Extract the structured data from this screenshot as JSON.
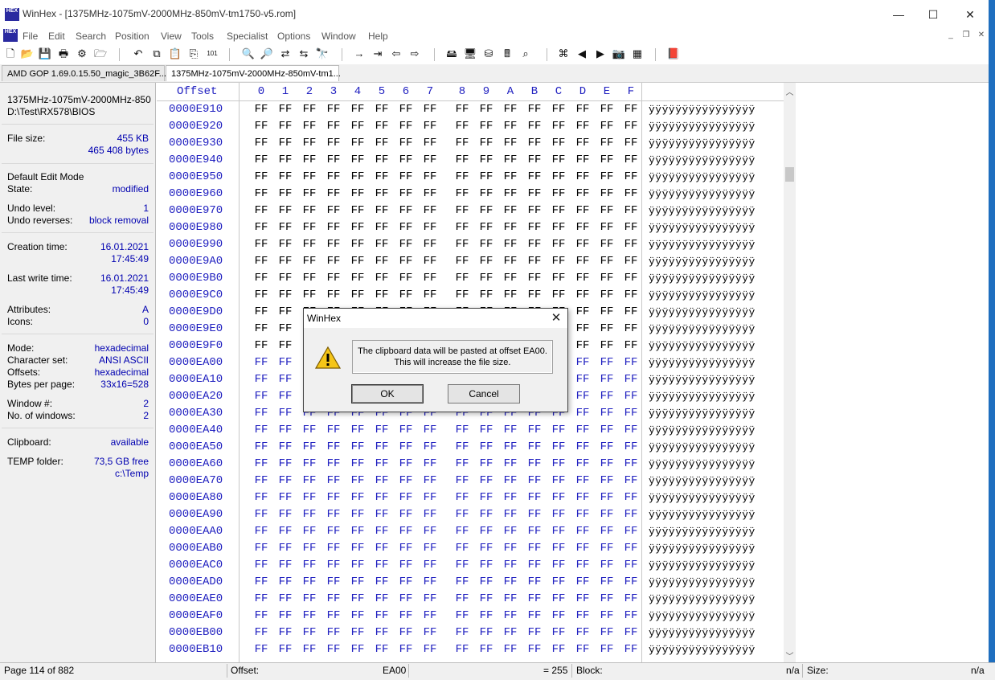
{
  "window": {
    "title": "WinHex - [1375MHz-1075mV-2000MHz-850mV-tm1750-v5.rom]",
    "app_icon_text": "HEX",
    "minimize_glyph": "—",
    "maximize_glyph": "☐",
    "close_glyph": "✕"
  },
  "menu": [
    "File",
    "Edit",
    "Search",
    "Position",
    "View",
    "Tools",
    "Specialist",
    "Options",
    "Window",
    "Help"
  ],
  "tabs": [
    {
      "label": "AMD GOP 1.69.0.15.50_magic_3B62F..."
    },
    {
      "label": "1375MHz-1075mV-2000MHz-850mV-tm1..."
    }
  ],
  "panel": {
    "filename": "1375MHz-1075mV-2000MHz-850",
    "path": "D:\\Test\\RX578\\BIOS",
    "file_size_label": "File size:",
    "file_size_kb": "455 KB",
    "file_size_bytes": "465 408 bytes",
    "edit_mode": "Default Edit Mode",
    "state_label": "State:",
    "state": "modified",
    "undo_level_label": "Undo level:",
    "undo_level": "1",
    "undo_reverses_label": "Undo reverses:",
    "undo_reverses": "block removal",
    "creation_label": "Creation time:",
    "creation_date": "16.01.2021",
    "creation_time": "17:45:49",
    "lastwrite_label": "Last write time:",
    "lastwrite_date": "16.01.2021",
    "lastwrite_time": "17:45:49",
    "attributes_label": "Attributes:",
    "attributes": "A",
    "icons_label": "Icons:",
    "icons": "0",
    "mode_label": "Mode:",
    "mode": "hexadecimal",
    "charset_label": "Character set:",
    "charset": "ANSI ASCII",
    "offsets_label": "Offsets:",
    "offsets": "hexadecimal",
    "bpp_label": "Bytes per page:",
    "bpp": "33x16=528",
    "window_no_label": "Window #:",
    "window_no": "2",
    "no_windows_label": "No. of windows:",
    "no_windows": "2",
    "clipboard_label": "Clipboard:",
    "clipboard": "available",
    "temp_label": "TEMP folder:",
    "temp_free": "73,5 GB free",
    "temp_path": "c:\\Temp"
  },
  "hex": {
    "offset_header": "Offset",
    "columns": [
      "0",
      "1",
      "2",
      "3",
      "4",
      "5",
      "6",
      "7",
      "8",
      "9",
      "A",
      "B",
      "C",
      "D",
      "E",
      "F"
    ],
    "rows": [
      {
        "offset": "0000E910",
        "blue": false
      },
      {
        "offset": "0000E920",
        "blue": false
      },
      {
        "offset": "0000E930",
        "blue": false
      },
      {
        "offset": "0000E940",
        "blue": false
      },
      {
        "offset": "0000E950",
        "blue": false
      },
      {
        "offset": "0000E960",
        "blue": false
      },
      {
        "offset": "0000E970",
        "blue": false
      },
      {
        "offset": "0000E980",
        "blue": false
      },
      {
        "offset": "0000E990",
        "blue": false
      },
      {
        "offset": "0000E9A0",
        "blue": false
      },
      {
        "offset": "0000E9B0",
        "blue": false
      },
      {
        "offset": "0000E9C0",
        "blue": false
      },
      {
        "offset": "0000E9D0",
        "blue": false
      },
      {
        "offset": "0000E9E0",
        "blue": false
      },
      {
        "offset": "0000E9F0",
        "blue": false
      },
      {
        "offset": "0000EA00",
        "blue": true
      },
      {
        "offset": "0000EA10",
        "blue": true
      },
      {
        "offset": "0000EA20",
        "blue": true
      },
      {
        "offset": "0000EA30",
        "blue": true
      },
      {
        "offset": "0000EA40",
        "blue": true
      },
      {
        "offset": "0000EA50",
        "blue": true
      },
      {
        "offset": "0000EA60",
        "blue": true
      },
      {
        "offset": "0000EA70",
        "blue": true
      },
      {
        "offset": "0000EA80",
        "blue": true
      },
      {
        "offset": "0000EA90",
        "blue": true
      },
      {
        "offset": "0000EAA0",
        "blue": true
      },
      {
        "offset": "0000EAB0",
        "blue": true
      },
      {
        "offset": "0000EAC0",
        "blue": true
      },
      {
        "offset": "0000EAD0",
        "blue": true
      },
      {
        "offset": "0000EAE0",
        "blue": true
      },
      {
        "offset": "0000EAF0",
        "blue": true
      },
      {
        "offset": "0000EB00",
        "blue": true
      },
      {
        "offset": "0000EB10",
        "blue": true
      }
    ],
    "byte_value": "FF",
    "ascii_text": "ÿÿÿÿÿÿÿÿÿÿÿÿÿÿÿÿ"
  },
  "status": {
    "page": "Page 114 of 882",
    "offset_label": "Offset:",
    "offset_value": "EA00",
    "eq_value": "= 255",
    "block_label": "Block:",
    "block_value": "n/a",
    "size_label": "Size:",
    "size_value": "n/a"
  },
  "dialog": {
    "title": "WinHex",
    "close_glyph": "✕",
    "message_line1": "The clipboard data will be pasted at offset EA00.",
    "message_line2": "This will increase the file size.",
    "ok_label": "OK",
    "cancel_label": "Cancel"
  },
  "colors": {
    "hex_blue": "#2020c0",
    "value_blue": "#0000b0",
    "taskbar_accent": "#1f6fbf"
  }
}
